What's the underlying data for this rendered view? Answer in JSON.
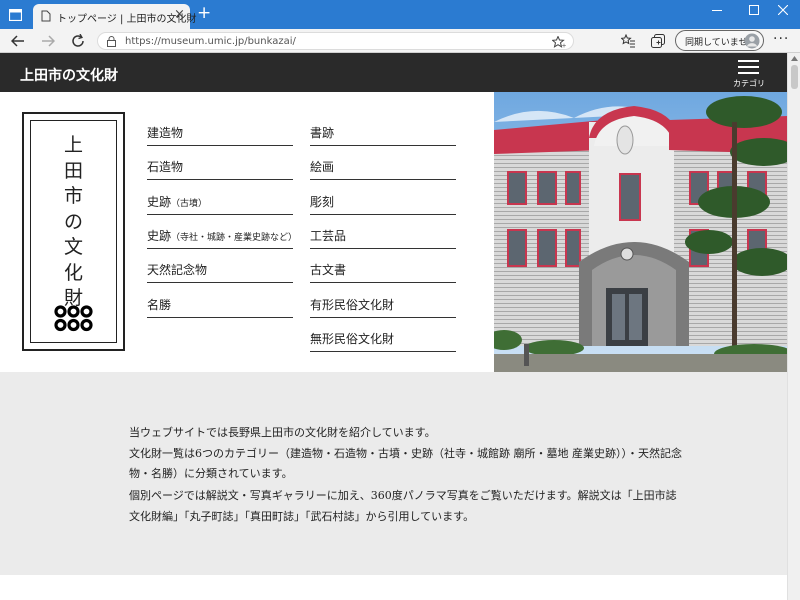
{
  "browser": {
    "tab_title": "トップページ | 上田市の文化財",
    "url": "https://museum.umic.jp/bunkazai/",
    "profile_label": "同期していません"
  },
  "site": {
    "title": "上田市の文化財",
    "menu_label": "カテゴリ",
    "seal_chars": [
      "上",
      "田",
      "市",
      "の",
      "文",
      "化",
      "財"
    ]
  },
  "categories": {
    "left": [
      {
        "label": "建造物",
        "sub": ""
      },
      {
        "label": "石造物",
        "sub": ""
      },
      {
        "label": "史跡",
        "sub": "（古墳）"
      },
      {
        "label": "史跡",
        "sub": "（寺社・城跡・産業史跡など）"
      },
      {
        "label": "天然記念物",
        "sub": ""
      },
      {
        "label": "名勝",
        "sub": ""
      }
    ],
    "right": [
      {
        "label": "書跡"
      },
      {
        "label": "絵画"
      },
      {
        "label": "彫刻"
      },
      {
        "label": "工芸品"
      },
      {
        "label": "古文書"
      },
      {
        "label": "有形民俗文化財"
      },
      {
        "label": "無形民俗文化財"
      }
    ]
  },
  "intro": {
    "lines": [
      "当ウェブサイトでは長野県上田市の文化財を紹介しています。",
      "文化財一覧は6つのカテゴリー（建造物・石造物・古墳・史跡（社寺・城館跡 廟所・墓地 産業史跡））・天然記念",
      "物・名勝）に分類されています。",
      "個別ページでは解説文・写真ギャラリーに加え、360度パノラマ写真をご覧いただけます。解説文は「上田市誌",
      "文化財編」「丸子町誌」「真田町誌」「武石村誌」から引用しています。"
    ]
  },
  "colors": {
    "header": "#2a2a2a",
    "tabstrip": "#2b7bd1",
    "intro_bg": "#ebebeb",
    "roof": "#c0304a"
  }
}
